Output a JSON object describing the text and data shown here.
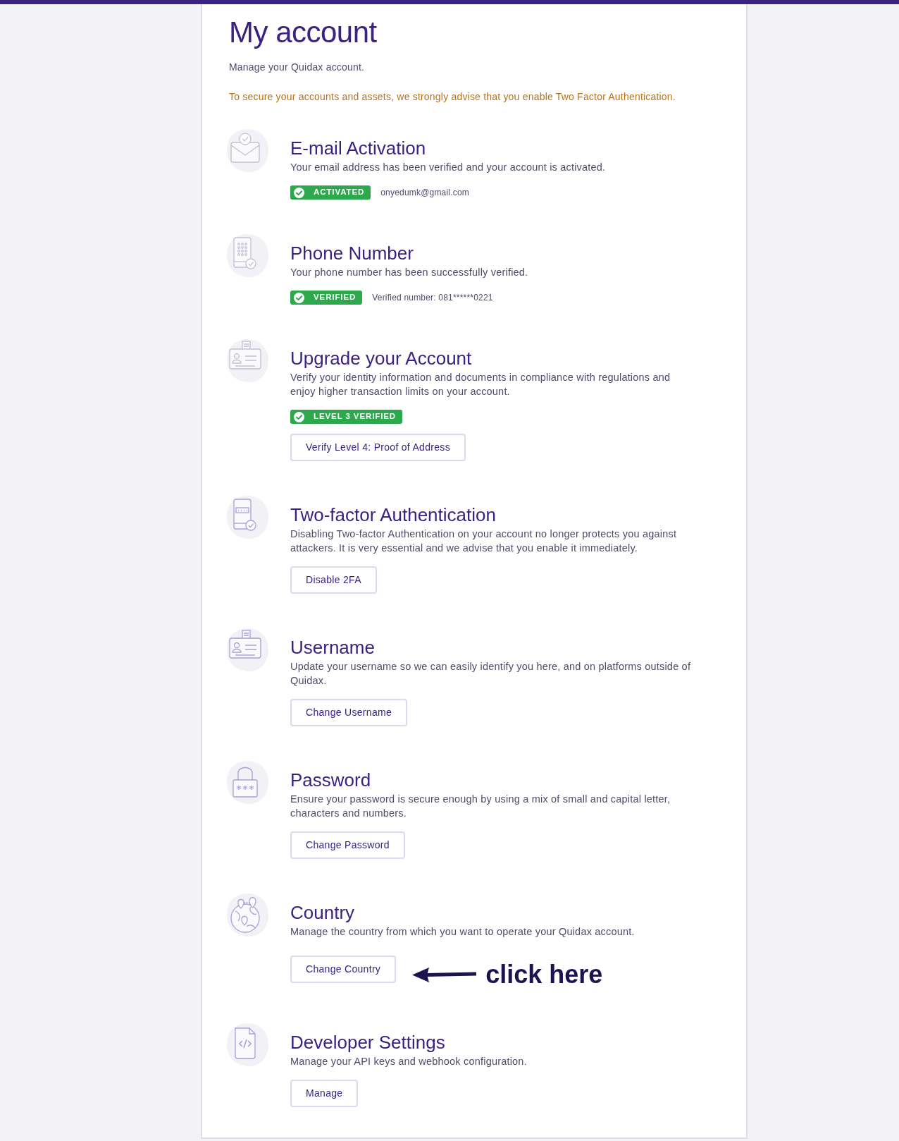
{
  "page": {
    "title": "My account",
    "subtitle": "Manage your Quidax account.",
    "notice": "To secure your accounts and assets, we strongly advise that you enable Two Factor Authentication."
  },
  "sections": [
    {
      "title": "E-mail Activation",
      "description": "Your email address has been verified and your account is activated.",
      "badge": "ACTIVATED",
      "detail": "onyedumk@gmail.com"
    },
    {
      "title": "Phone Number",
      "description": "Your phone number has been successfully verified.",
      "badge": "VERIFIED",
      "detail": "Verified number: 081******0221"
    },
    {
      "title": "Upgrade your Account",
      "description": "Verify your identity information and documents in compliance with regulations and enjoy higher transaction limits on your account.",
      "badge": "LEVEL 3 VERIFIED",
      "button": "Verify Level 4: Proof of Address"
    },
    {
      "title": "Two-factor Authentication",
      "description": "Disabling Two-factor Authentication on your account no longer protects you against attackers. It is very essential and we advise that you enable it immediately.",
      "button": "Disable 2FA"
    },
    {
      "title": "Username",
      "description": "Update your username so we can easily identify you here, and on platforms outside of Quidax.",
      "button": "Change Username"
    },
    {
      "title": "Password",
      "description": "Ensure your password is secure enough by using a mix of small and capital letter, characters and numbers.",
      "button": "Change Password"
    },
    {
      "title": "Country",
      "description": "Manage the country from which you want to operate your Quidax account.",
      "button": "Change Country",
      "annotation": "click here"
    },
    {
      "title": "Developer Settings",
      "description": "Manage your API keys and webhook configuration.",
      "button": "Manage"
    }
  ]
}
